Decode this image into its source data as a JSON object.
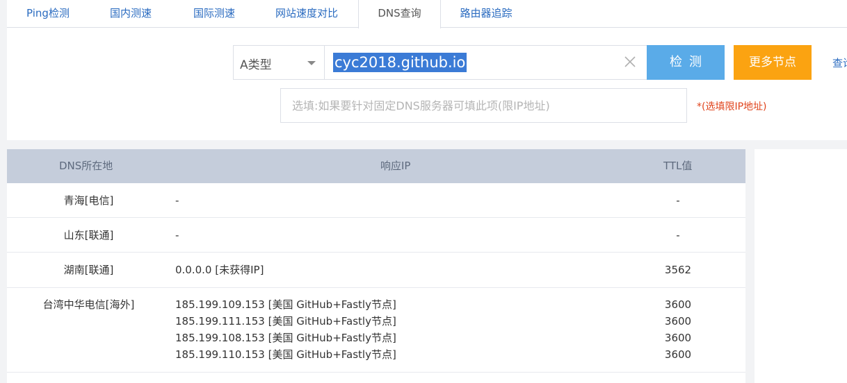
{
  "tabs": [
    {
      "label": "Ping检测",
      "active": false
    },
    {
      "label": "国内测速",
      "active": false
    },
    {
      "label": "国际测速",
      "active": false
    },
    {
      "label": "网站速度对比",
      "active": false
    },
    {
      "label": "DNS查询",
      "active": true
    },
    {
      "label": "路由器追踪",
      "active": false
    }
  ],
  "query": {
    "record_type": "A类型",
    "domain": "cyc2018.github.io",
    "check_button": "检测",
    "more_nodes_button": "更多节点",
    "query_link": "查询",
    "dns_server_placeholder": "选填:如果要针对固定DNS服务器可填此项(限IP地址)",
    "dns_server_note": "*(选填限IP地址)"
  },
  "table": {
    "headers": {
      "location": "DNS所在地",
      "ip": "响应IP",
      "ttl": "TTL值"
    },
    "rows": [
      {
        "location": "青海[电信]",
        "ips": [
          "-"
        ],
        "ttls": [
          "-"
        ]
      },
      {
        "location": "山东[联通]",
        "ips": [
          "-"
        ],
        "ttls": [
          "-"
        ]
      },
      {
        "location": "湖南[联通]",
        "ips": [
          "0.0.0.0 [未获得IP]"
        ],
        "ttls": [
          "3562"
        ]
      },
      {
        "location": "台湾中华电信[海外]",
        "ips": [
          "185.199.109.153 [美国 GitHub+Fastly节点]",
          "185.199.111.153 [美国 GitHub+Fastly节点]",
          "185.199.108.153 [美国 GitHub+Fastly节点]",
          "185.199.110.153 [美国 GitHub+Fastly节点]"
        ],
        "ttls": [
          "3600",
          "3600",
          "3600",
          "3600"
        ]
      }
    ]
  },
  "colors": {
    "tab_link": "#2a6bc0",
    "check_button": "#5aabe8",
    "more_button": "#fba311",
    "note_red": "#e0431b",
    "table_header": "#c5cddb",
    "selection": "#3b7bd6"
  }
}
